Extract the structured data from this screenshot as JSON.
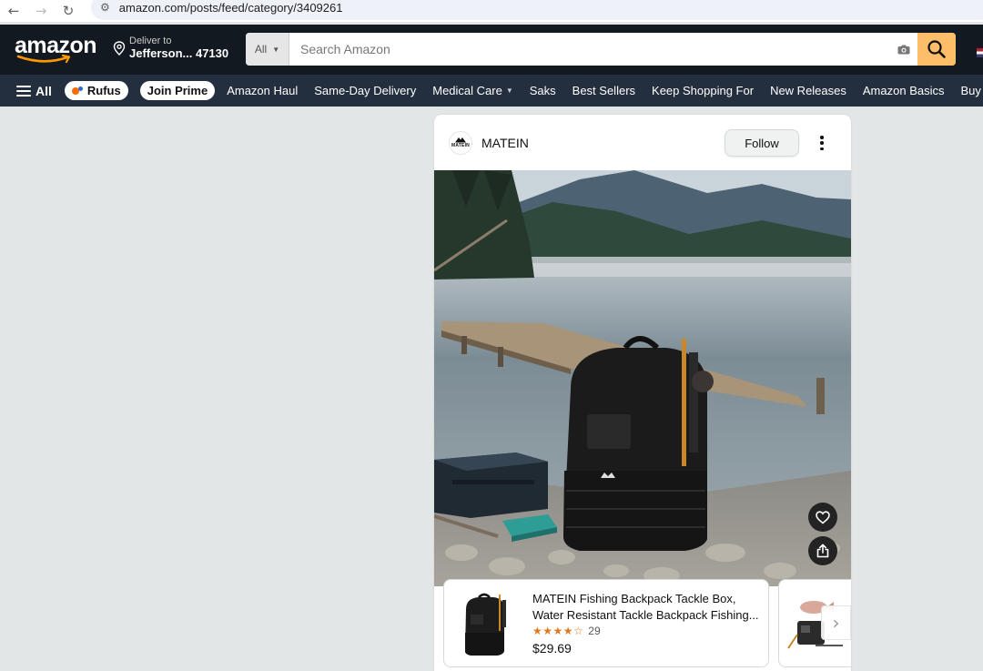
{
  "browser": {
    "url": "amazon.com/posts/feed/category/3409261",
    "back_icon": "←",
    "forward_icon": "→",
    "reload_icon": "↻",
    "site_info_icon": "⚙"
  },
  "header": {
    "logo_text": "amazon",
    "deliver_to_label": "Deliver to",
    "deliver_location": "Jefferson... 47130",
    "search": {
      "category": "All",
      "placeholder": "Search Amazon"
    }
  },
  "nav": {
    "all_label": "All",
    "rufus_label": "Rufus",
    "prime_label": "Join Prime",
    "links": [
      "Amazon Haul",
      "Same-Day Delivery",
      "Medical Care",
      "Saks",
      "Best Sellers",
      "Keep Shopping For",
      "New Releases",
      "Amazon Basics",
      "Buy Again"
    ]
  },
  "post": {
    "brand_name": "MATEIN",
    "avatar_text": "MATEIN",
    "follow_label": "Follow",
    "products": [
      {
        "title_line1": "MATEIN Fishing Backpack Tackle Box,",
        "title_line2": "Water Resistant Tackle Backpack Fishing...",
        "rating": 4.5,
        "stars": "★★★★☆",
        "rating_count": "29",
        "price": "$29.69"
      }
    ]
  },
  "colors": {
    "header_bg": "#131921",
    "nav_bg": "#232f3e",
    "search_button": "#febd69",
    "page_bg": "#e3e6e6",
    "star": "#de7921"
  },
  "icons": {
    "location": "location-pin-icon",
    "search": "magnifier-icon",
    "camera": "camera-icon",
    "heart": "heart-icon",
    "share": "share-icon",
    "more": "more-vertical-icon",
    "next": "chevron-right-icon"
  }
}
